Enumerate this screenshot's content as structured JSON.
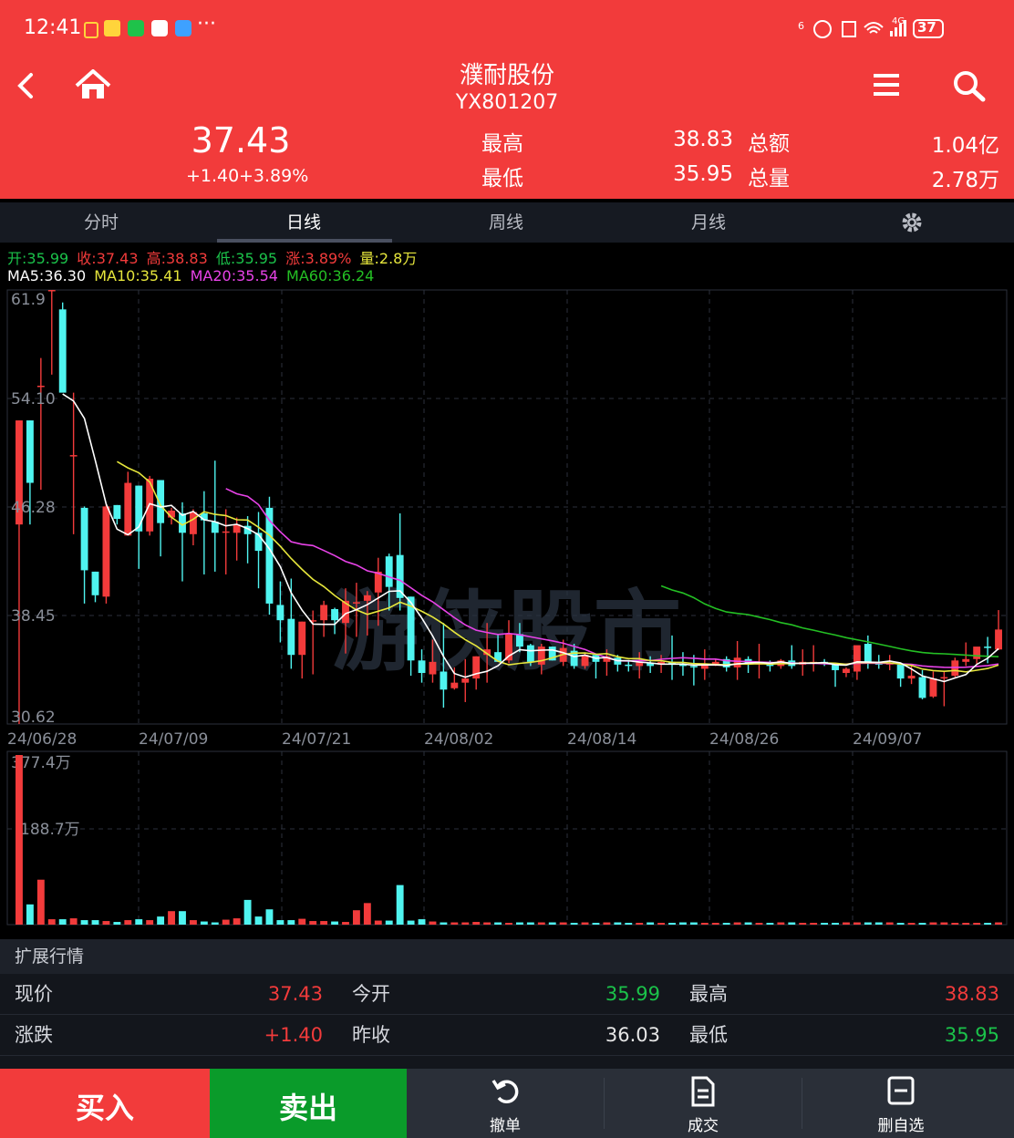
{
  "status_bar": {
    "time": "12:41",
    "battery": "37",
    "network": "4G",
    "signal_suffix": "6"
  },
  "header": {
    "stock_name": "濮耐股份",
    "stock_code": "YX801207",
    "price": "37.43",
    "change": "+1.40",
    "change_pct": "+3.89%",
    "high_label": "最高",
    "high_value": "38.83",
    "low_label": "最低",
    "low_value": "35.95",
    "amount_label": "总额",
    "amount_value": "1.04亿",
    "volume_label": "总量",
    "volume_value": "2.78万"
  },
  "tabs": [
    {
      "label": "分时",
      "active": false
    },
    {
      "label": "日线",
      "active": true
    },
    {
      "label": "周线",
      "active": false
    },
    {
      "label": "月线",
      "active": false
    }
  ],
  "info_line1": {
    "open": "开:35.99",
    "close": "收:37.43",
    "high": "高:38.83",
    "low": "低:35.95",
    "change": "涨:3.89%",
    "volume": "量:2.8万"
  },
  "info_line2": {
    "ma5": "MA5:36.30",
    "ma10": "MA10:35.41",
    "ma20": "MA20:35.54",
    "ma60": "MA60:36.24"
  },
  "watermark": "游侠股市",
  "chart_data": {
    "type": "candlestick",
    "price_axis": [
      "61.9",
      "54.10",
      "46.28",
      "38.45",
      "30.62"
    ],
    "ylim": [
      30.62,
      61.9
    ],
    "date_labels": [
      "24/06/28",
      "24/07/09",
      "24/07/21",
      "24/08/02",
      "24/08/14",
      "24/08/26",
      "24/09/07"
    ],
    "volume_axis": [
      "377.4万",
      "188.7万"
    ],
    "candles": [
      [
        45,
        52.5,
        30.6,
        52.5
      ],
      [
        52.5,
        52.5,
        45,
        48
      ],
      [
        55,
        57,
        47.5,
        55
      ],
      [
        62,
        63,
        55.8,
        62
      ],
      [
        60.5,
        61,
        55.5,
        54.5
      ],
      [
        50,
        54.5,
        44.3,
        50
      ],
      [
        46.2,
        46.3,
        39.3,
        41.7
      ],
      [
        41.6,
        41.6,
        39.4,
        39.9
      ],
      [
        39.8,
        46.5,
        39.3,
        46.3
      ],
      [
        46.4,
        46.4,
        45,
        45.4
      ],
      [
        44.2,
        48.8,
        44.3,
        48
      ],
      [
        47.8,
        47.8,
        41.8,
        44.5
      ],
      [
        44.5,
        48.5,
        44.2,
        48.3
      ],
      [
        48.2,
        48.2,
        42.7,
        45.1
      ],
      [
        45.5,
        46.2,
        45,
        46
      ],
      [
        45.8,
        46.6,
        40.9,
        44.4
      ],
      [
        44.3,
        46.1,
        43.5,
        45.9
      ],
      [
        45.8,
        47.4,
        41.4,
        45.3
      ],
      [
        45.2,
        49.6,
        41.6,
        44.4
      ],
      [
        44.5,
        46.1,
        41.4,
        44.5
      ],
      [
        44.4,
        45.5,
        42.4,
        45
      ],
      [
        44.9,
        45.6,
        42.2,
        44.3
      ],
      [
        44.4,
        45.9,
        40.4,
        43.1
      ],
      [
        46.2,
        47,
        38.5,
        39.3
      ],
      [
        39.2,
        40.9,
        36.5,
        38.1
      ],
      [
        38.2,
        41.1,
        34.6,
        35.6
      ],
      [
        35.6,
        38,
        33.9,
        38
      ],
      [
        38.1,
        38.8,
        34.2,
        38.1
      ],
      [
        38.1,
        39.5,
        36.9,
        39.2
      ],
      [
        38.9,
        39,
        37.1,
        38.1
      ],
      [
        37.9,
        40.4,
        35.7,
        39.5
      ],
      [
        39.4,
        40.8,
        36.9,
        39.4
      ],
      [
        39.5,
        40.2,
        37,
        39.9
      ],
      [
        40.1,
        42.6,
        37.7,
        41.6
      ],
      [
        42.7,
        42.9,
        38.8,
        40.5
      ],
      [
        42.8,
        45.8,
        38.8,
        39.7
      ],
      [
        39.8,
        39.8,
        34.1,
        35.2
      ],
      [
        35.2,
        36,
        33.6,
        34.3
      ],
      [
        34.2,
        36.7,
        33.6,
        35.1
      ],
      [
        34.4,
        37.9,
        31.8,
        33.1
      ],
      [
        33.2,
        34.7,
        33.1,
        33.6
      ],
      [
        33.6,
        35.3,
        32.2,
        33.9
      ],
      [
        33.9,
        35.5,
        33.1,
        35.5
      ],
      [
        35.6,
        37.9,
        33.6,
        36
      ],
      [
        35.8,
        37.1,
        35.3,
        35.1
      ],
      [
        35.2,
        38.1,
        35,
        37.1
      ],
      [
        37.1,
        37.9,
        35.8,
        36.2
      ],
      [
        36.3,
        36.4,
        34.8,
        35.1
      ],
      [
        34.9,
        36.4,
        34.2,
        36.2
      ],
      [
        36.2,
        36.2,
        35.2,
        35.2
      ],
      [
        35.1,
        36.7,
        34.8,
        36.1
      ],
      [
        35.9,
        36.4,
        34.6,
        34.8
      ],
      [
        34.8,
        35.7,
        34.6,
        35.6
      ],
      [
        35.6,
        35.6,
        33.9,
        35.1
      ],
      [
        35.1,
        36,
        34.1,
        35.5
      ],
      [
        35.4,
        35.6,
        34.4,
        34.9
      ],
      [
        34.9,
        35.2,
        34.4,
        34.8
      ],
      [
        34.8,
        35.8,
        33.9,
        35.1
      ],
      [
        35,
        35.5,
        34.3,
        34.8
      ],
      [
        34.9,
        35.6,
        34.3,
        35.1
      ],
      [
        35.1,
        37,
        33.8,
        34.9
      ],
      [
        34.9,
        35.8,
        34.1,
        34.8
      ],
      [
        34.8,
        35.6,
        33.4,
        34.7
      ],
      [
        34.6,
        36,
        33.8,
        34.9
      ],
      [
        34.9,
        35.3,
        34.8,
        35.1
      ],
      [
        35.3,
        35.5,
        34.4,
        34.7
      ],
      [
        34.7,
        36.6,
        33.8,
        35.4
      ],
      [
        35.3,
        35.5,
        34.3,
        35
      ],
      [
        34.9,
        36.4,
        33.9,
        35.1
      ],
      [
        35,
        35.2,
        34.4,
        34.8
      ],
      [
        34.8,
        35.3,
        34.6,
        35.2
      ],
      [
        35.2,
        36.3,
        34.6,
        34.8
      ],
      [
        34.9,
        36,
        34.1,
        35.1
      ],
      [
        35,
        36.3,
        34.4,
        35.1
      ],
      [
        35.1,
        35.3,
        34.8,
        35
      ],
      [
        34.9,
        35,
        33.3,
        34.5
      ],
      [
        34.3,
        34.7,
        34,
        34.6
      ],
      [
        34.4,
        35.8,
        33.8,
        36.3
      ],
      [
        36.4,
        37,
        34.6,
        35
      ],
      [
        35,
        35.6,
        34.6,
        34.9
      ],
      [
        34.9,
        35.6,
        34.5,
        35
      ],
      [
        34.9,
        34.9,
        33.3,
        33.9
      ],
      [
        33.9,
        34.9,
        33.5,
        34.1
      ],
      [
        34,
        34.5,
        32.4,
        32.5
      ],
      [
        32.6,
        34.4,
        32.5,
        33.9
      ],
      [
        33.9,
        34.4,
        31.9,
        34
      ],
      [
        34.1,
        35.4,
        34,
        35.2
      ],
      [
        35.1,
        36.5,
        34.8,
        35.3
      ],
      [
        35.3,
        36.1,
        34.9,
        36.2
      ],
      [
        36.2,
        36.9,
        35,
        36.1
      ],
      [
        35.99,
        38.83,
        35.95,
        37.43
      ]
    ],
    "volumes": [
      377.4,
      45,
      100,
      12,
      12,
      14,
      10,
      10,
      8,
      6,
      10,
      12,
      10,
      18,
      30,
      30,
      10,
      7,
      5,
      11,
      14,
      55,
      18,
      34,
      10,
      10,
      13,
      8,
      8,
      7,
      6,
      32,
      48,
      9,
      9,
      88,
      9,
      12,
      7,
      5,
      5,
      5,
      6,
      5,
      5,
      4,
      5,
      5,
      5,
      5,
      5,
      4,
      5,
      4,
      5,
      5,
      4,
      4,
      5,
      4,
      4,
      5,
      5,
      4,
      4,
      4,
      5,
      5,
      4,
      4,
      5,
      5,
      4,
      4,
      4,
      4,
      5,
      5,
      5,
      5,
      5,
      4,
      4,
      4,
      5,
      5,
      4,
      4,
      4,
      4,
      5
    ],
    "ma5_start": 4,
    "ma10_start": 9,
    "ma20_start": 19,
    "ma60_start": 59,
    "colors": {
      "up": "#f23b3b",
      "down": "#4ff4f0",
      "ma5": "#ffffff",
      "ma10": "#e6e63c",
      "ma20": "#e843e8",
      "ma60": "#24c024"
    }
  },
  "extended": {
    "title": "扩展行情",
    "rows": [
      [
        {
          "label": "现价",
          "value": "37.43",
          "color": "red"
        },
        {
          "label": "今开",
          "value": "35.99",
          "color": "green"
        },
        {
          "label": "最高",
          "value": "38.83",
          "color": "red"
        }
      ],
      [
        {
          "label": "涨跌",
          "value": "+1.40",
          "color": "red"
        },
        {
          "label": "昨收",
          "value": "36.03",
          "color": "white"
        },
        {
          "label": "最低",
          "value": "35.95",
          "color": "green"
        }
      ]
    ]
  },
  "bottom_bar": {
    "buy": "买入",
    "sell": "卖出",
    "tools": [
      {
        "label": "撤单",
        "icon": "undo-icon"
      },
      {
        "label": "成交",
        "icon": "document-icon"
      },
      {
        "label": "删自选",
        "icon": "remove-favorite-icon"
      }
    ]
  }
}
